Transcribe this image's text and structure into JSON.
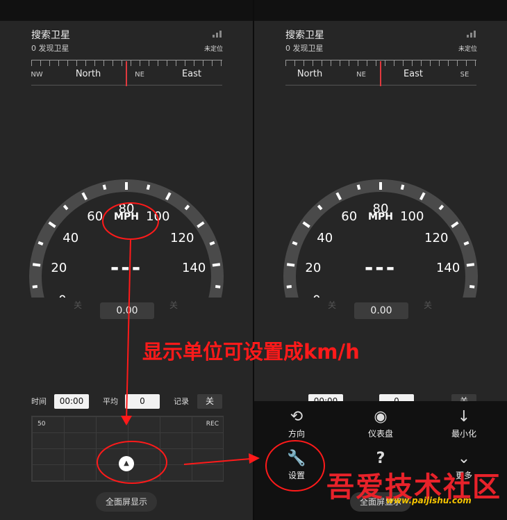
{
  "left": {
    "sat_title": "搜索卫星",
    "sat_count": "0 发现卫星",
    "fix_status": "未定位",
    "compass": [
      "NW",
      "North",
      "NE",
      "East"
    ],
    "speed_unit": "MPH",
    "speed_value": "---",
    "gauge_labels": [
      "0",
      "20",
      "40",
      "60",
      "80",
      "100",
      "120",
      "140"
    ],
    "ghost_left": "关",
    "ghost_right": "关",
    "distance": "0.00",
    "time_label": "时间",
    "time_value": "00:00",
    "avg_label": "平均",
    "avg_value": "0",
    "rec_label": "记录",
    "rec_value": "关",
    "graph_max": "50",
    "graph_rec": "REC",
    "up_glyph": "▲",
    "fullscreen": "全面屏显示"
  },
  "right": {
    "sat_title": "搜索卫星",
    "sat_count": "0 发现卫星",
    "fix_status": "未定位",
    "compass": [
      "North",
      "NE",
      "East",
      "SE"
    ],
    "speed_unit": "MPH",
    "speed_value": "---",
    "gauge_labels": [
      "0",
      "20",
      "40",
      "60",
      "80",
      "100",
      "120",
      "140"
    ],
    "ghost_left": "关",
    "ghost_right": "关",
    "distance": "0.00",
    "time_value": "00:00",
    "avg_value": "0",
    "rec_value": "关",
    "menu": [
      {
        "icon": "rotate-icon",
        "glyph": "⟲",
        "label": "方向"
      },
      {
        "icon": "eye-icon",
        "glyph": "◉",
        "label": "仪表盘"
      },
      {
        "icon": "arrow-down-icon",
        "glyph": "↓",
        "label": "最小化"
      },
      {
        "icon": "wrench-icon",
        "glyph": "🔧",
        "label": "设置"
      },
      {
        "icon": "help-icon",
        "glyph": "?",
        "label": ""
      },
      {
        "icon": "chevron-down-circle-icon",
        "glyph": "⌄",
        "label": "更多"
      }
    ],
    "fullscreen": "全面屏显示"
  },
  "annotation": "显示单位可设置成km/h",
  "watermark": {
    "text": "吾爱技术社区",
    "url": "www.paijishu.com"
  },
  "colors": {
    "accent_red": "#ff1a1a",
    "needle": "#e0393e",
    "watermark_yellow": "#f5c400"
  }
}
